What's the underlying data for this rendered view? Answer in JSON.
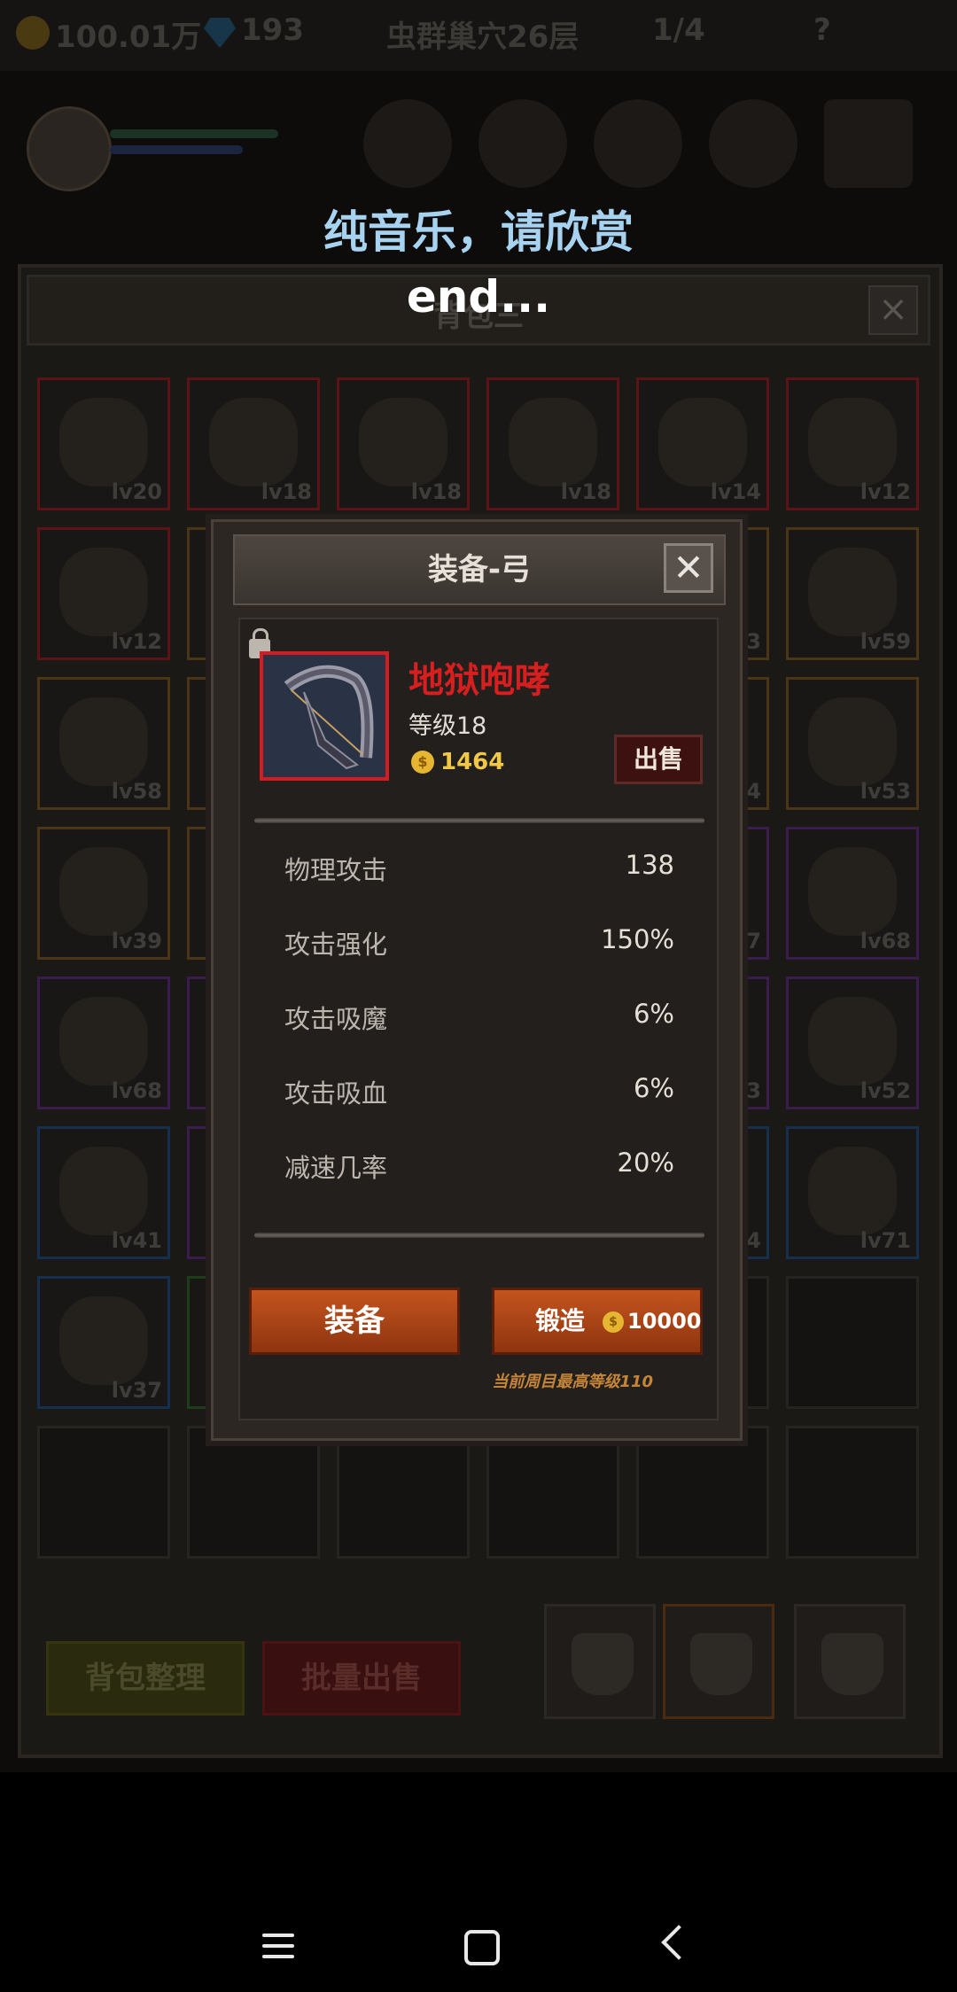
{
  "status_bar": {
    "gold": "100.01万",
    "gems": "193",
    "dungeon": "虫群巢穴26层",
    "kills": "1/4",
    "help": "?"
  },
  "overlay": {
    "caption_line1": "纯音乐，请欣赏",
    "caption_line2": "end..."
  },
  "backpack": {
    "title": "背包三",
    "grid": [
      {
        "lv": "lv20",
        "rarity": "r"
      },
      {
        "lv": "lv18",
        "rarity": "r"
      },
      {
        "lv": "lv18",
        "rarity": "r"
      },
      {
        "lv": "lv18",
        "rarity": "r"
      },
      {
        "lv": "lv14",
        "rarity": "r"
      },
      {
        "lv": "lv12",
        "rarity": "r"
      },
      {
        "lv": "lv12",
        "rarity": "r"
      },
      {
        "lv": "",
        "rarity": "o"
      },
      {
        "lv": "",
        "rarity": "o"
      },
      {
        "lv": "",
        "rarity": "o"
      },
      {
        "lv": "3",
        "rarity": "o"
      },
      {
        "lv": "lv59",
        "rarity": "o"
      },
      {
        "lv": "lv58",
        "rarity": "o"
      },
      {
        "lv": "",
        "rarity": "o"
      },
      {
        "lv": "",
        "rarity": "o"
      },
      {
        "lv": "",
        "rarity": "o"
      },
      {
        "lv": "4",
        "rarity": "o"
      },
      {
        "lv": "lv53",
        "rarity": "o"
      },
      {
        "lv": "lv39",
        "rarity": "o"
      },
      {
        "lv": "",
        "rarity": "o"
      },
      {
        "lv": "",
        "rarity": "o"
      },
      {
        "lv": "",
        "rarity": "o"
      },
      {
        "lv": "7",
        "rarity": "p"
      },
      {
        "lv": "lv68",
        "rarity": "p"
      },
      {
        "lv": "lv68",
        "rarity": "p"
      },
      {
        "lv": "",
        "rarity": "p"
      },
      {
        "lv": "",
        "rarity": "p"
      },
      {
        "lv": "",
        "rarity": "p"
      },
      {
        "lv": "3",
        "rarity": "p"
      },
      {
        "lv": "lv52",
        "rarity": "p"
      },
      {
        "lv": "lv41",
        "rarity": "b"
      },
      {
        "lv": "",
        "rarity": "p"
      },
      {
        "lv": "",
        "rarity": "p"
      },
      {
        "lv": "",
        "rarity": "p"
      },
      {
        "lv": "4",
        "rarity": "b"
      },
      {
        "lv": "lv71",
        "rarity": "b"
      },
      {
        "lv": "lv37",
        "rarity": "b"
      },
      {
        "lv": "",
        "rarity": "g"
      },
      {
        "lv": "",
        "rarity": "e"
      },
      {
        "lv": "",
        "rarity": "e"
      },
      {
        "lv": "",
        "rarity": "e"
      },
      {
        "lv": "",
        "rarity": "e"
      },
      {
        "lv": "",
        "rarity": "e"
      },
      {
        "lv": "",
        "rarity": "e"
      },
      {
        "lv": "",
        "rarity": "e"
      },
      {
        "lv": "",
        "rarity": "e"
      },
      {
        "lv": "",
        "rarity": "e"
      },
      {
        "lv": "",
        "rarity": "e"
      }
    ],
    "sort_label": "背包整理",
    "bulk_sell_label": "批量出售"
  },
  "dialog": {
    "title": "装备-弓",
    "close": "✕",
    "item": {
      "name": "地狱咆哮",
      "level": "等级18",
      "price": "1464",
      "sell_label": "出售"
    },
    "stats": [
      {
        "label": "物理攻击",
        "value": "138"
      },
      {
        "label": "攻击强化",
        "value": "150%"
      },
      {
        "label": "攻击吸魔",
        "value": "6%"
      },
      {
        "label": "攻击吸血",
        "value": "6%"
      },
      {
        "label": "减速几率",
        "value": "20%"
      }
    ],
    "equip_label": "装备",
    "forge_label": "锻造",
    "forge_cost": "10000",
    "note": "当前周目最高等级110"
  },
  "colors": {
    "rarity_red": "#d41c22",
    "item_name": "#d81f20",
    "price_gold": "#f0c846",
    "button_orange": "#c4541d",
    "caption_blue": "#a7d3f0"
  }
}
